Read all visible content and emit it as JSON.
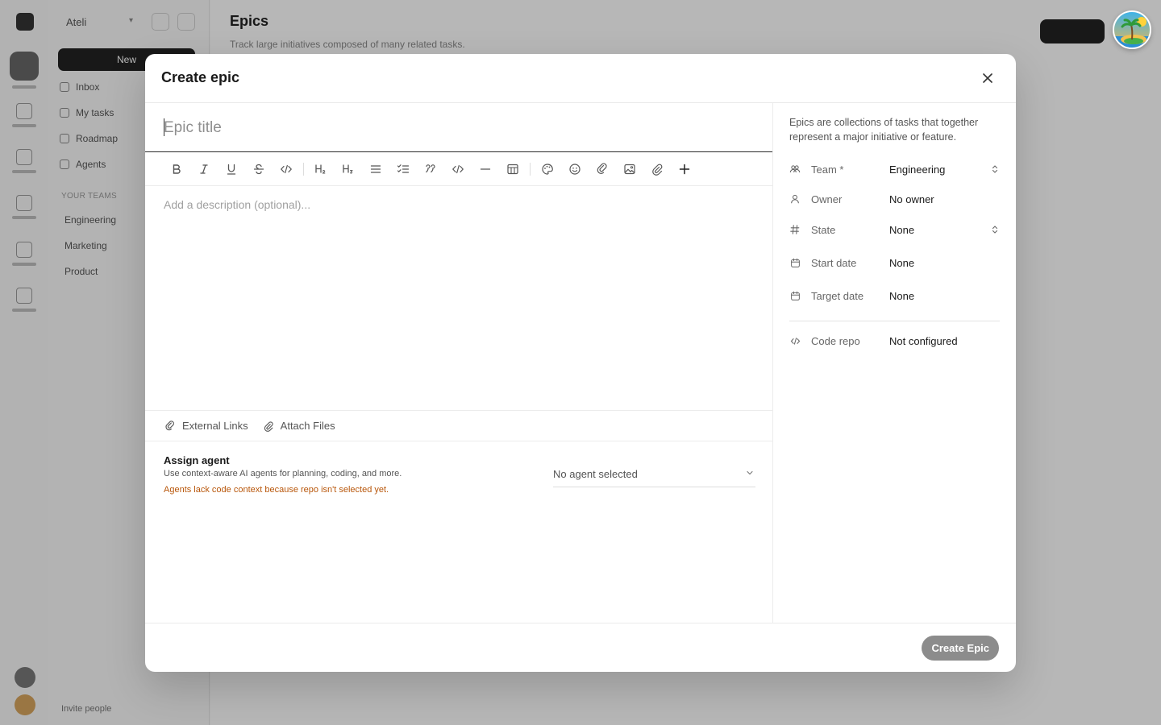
{
  "background": {
    "workspace_name": "Ateli",
    "new_button_label": "New",
    "nav_items": [
      "Inbox",
      "My tasks",
      "Roadmap",
      "Agents"
    ],
    "teams_heading": "YOUR TEAMS",
    "teams": [
      "Engineering",
      "Marketing",
      "Product"
    ],
    "footer_label": "Invite people",
    "page_title": "Epics",
    "page_subtitle": "Track large initiatives composed of many related tasks."
  },
  "modal": {
    "title": "Create epic",
    "title_placeholder": "Epic title",
    "description_placeholder": "Add a description (optional)...",
    "toolbar": [
      {
        "name": "bold",
        "icon": "bold-icon"
      },
      {
        "name": "italic",
        "icon": "italic-icon"
      },
      {
        "name": "underline",
        "icon": "underline-icon"
      },
      {
        "name": "strikethrough",
        "icon": "strikethrough-icon"
      },
      {
        "name": "inline-code",
        "icon": "code-icon"
      },
      {
        "name": "heading-2",
        "icon": "heading-2-icon"
      },
      {
        "name": "heading-3",
        "icon": "heading-3-icon"
      },
      {
        "name": "bullet-list",
        "icon": "list-icon"
      },
      {
        "name": "task-list",
        "icon": "checklist-icon"
      },
      {
        "name": "quote",
        "icon": "quote-icon"
      },
      {
        "name": "code-block",
        "icon": "code-block-icon"
      },
      {
        "name": "horizontal-rule",
        "icon": "minus-icon"
      },
      {
        "name": "table",
        "icon": "table-icon"
      },
      {
        "name": "color",
        "icon": "palette-icon"
      },
      {
        "name": "emoji",
        "icon": "smiley-icon"
      },
      {
        "name": "link",
        "icon": "link-icon"
      },
      {
        "name": "image",
        "icon": "image-icon"
      },
      {
        "name": "attachment",
        "icon": "paperclip-icon"
      },
      {
        "name": "more",
        "icon": "plus-icon"
      }
    ],
    "attachments": {
      "external_links_label": "External Links",
      "attach_files_label": "Attach Files"
    },
    "agent": {
      "title": "Assign agent",
      "description": "Use context-aware AI agents for planning, coding, and more.",
      "warning": "Agents lack code context because repo isn't selected yet.",
      "selected_value": "No agent selected"
    },
    "sidebar": {
      "help_text": "Epics are collections of tasks that together represent a major initiative or feature.",
      "properties": {
        "team": {
          "label": "Team *",
          "value": "Engineering"
        },
        "owner": {
          "label": "Owner",
          "value": "No owner"
        },
        "state": {
          "label": "State",
          "value": "None"
        },
        "start_date": {
          "label": "Start date",
          "value": "None"
        },
        "target_date": {
          "label": "Target date",
          "value": "None"
        },
        "code_repo": {
          "label": "Code repo",
          "value": "Not configured"
        }
      }
    },
    "footer": {
      "create_button_label": "Create Epic"
    }
  },
  "colors": {
    "warning": "#b8560a",
    "primary_disabled": "#8c8c8c",
    "overlay": "rgba(0,0,0,0.27)"
  }
}
